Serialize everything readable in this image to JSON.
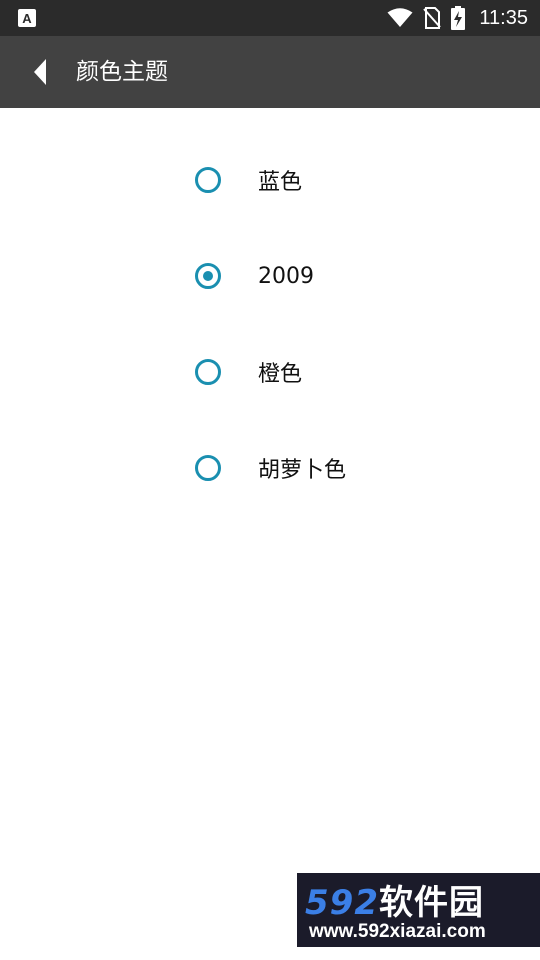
{
  "status_bar": {
    "left_icon": "app-a-icon",
    "left_icon_glyph": "A",
    "icons": [
      "wifi-icon",
      "no-sim-icon",
      "battery-charging-icon"
    ],
    "time": "11:35"
  },
  "app_bar": {
    "back_icon": "back-arrow-icon",
    "title": "颜色主题"
  },
  "options": [
    {
      "label": "蓝色",
      "selected": false
    },
    {
      "label": "2009",
      "selected": true
    },
    {
      "label": "橙色",
      "selected": false
    },
    {
      "label": "胡萝卜色",
      "selected": false
    }
  ],
  "accent_color": "#1a8fb0",
  "watermark": {
    "brand_number": "592",
    "brand_text": "软件园",
    "url": "www.592xiazai.com"
  }
}
